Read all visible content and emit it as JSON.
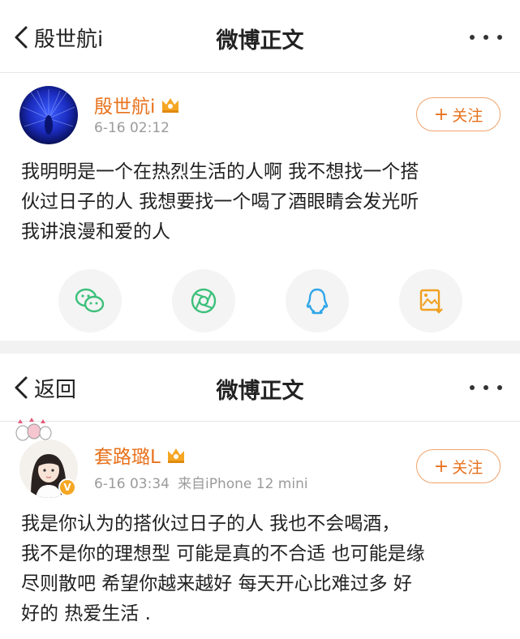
{
  "colors": {
    "accent": "#e8721c",
    "meta": "#9b9b9b",
    "text": "#222222"
  },
  "post1": {
    "nav": {
      "back_label": "殷世航i",
      "title": "微博正文",
      "more_icon": "ellipsis-icon"
    },
    "user": {
      "name": "殷世航i",
      "time": "6-16 02:12",
      "badge_icon": "vip-crown-icon"
    },
    "follow_label": "关注",
    "content_lines": [
      "我明明是一个在热烈生活的人啊 我不想找一个搭",
      "伙过日子的人 我想要找一个喝了酒眼睛会发光听",
      "我讲浪漫和爱的人"
    ],
    "share": [
      "wechat-icon",
      "moments-icon",
      "qq-icon",
      "save-image-icon"
    ]
  },
  "post2": {
    "nav": {
      "back_label": "返回",
      "title": "微博正文",
      "more_icon": "ellipsis-icon"
    },
    "user": {
      "name": "套路璐L",
      "time": "6-16 03:34",
      "source": "来自iPhone 12 mini",
      "badge_icon": "vip-crown-icon"
    },
    "follow_label": "关注",
    "content_lines": [
      "我是你认为的搭伙过日子的人 我也不会喝酒，",
      "我不是你的理想型 可能是真的不合适 也可能是缘",
      "尽则散吧 希望你越来越好 每天开心比难过多 好",
      "好的 热爱生活 ."
    ]
  }
}
